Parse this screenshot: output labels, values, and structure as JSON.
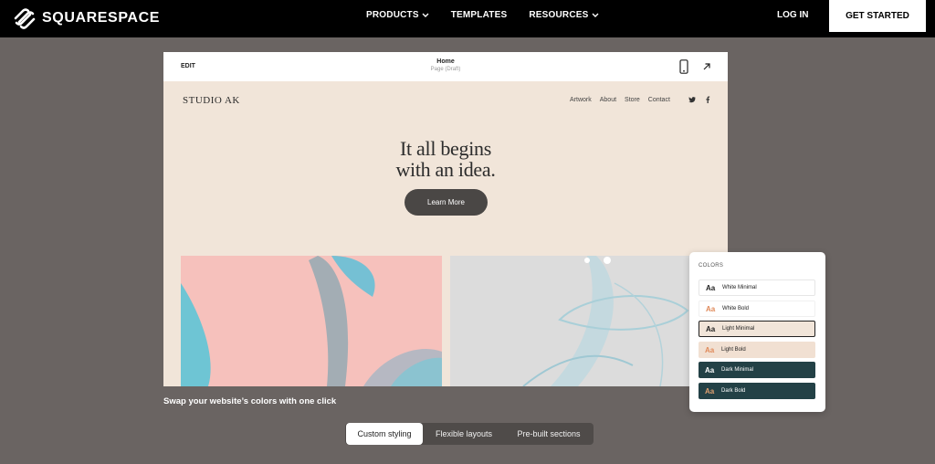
{
  "nav": {
    "brand": "SQUARESPACE",
    "items": [
      {
        "label": "PRODUCTS",
        "has_dropdown": true
      },
      {
        "label": "TEMPLATES",
        "has_dropdown": false
      },
      {
        "label": "RESOURCES",
        "has_dropdown": true
      }
    ],
    "login": "LOG IN",
    "cta": "GET STARTED"
  },
  "editor": {
    "edit_label": "EDIT",
    "page_title": "Home",
    "page_subtitle": "Page (Draft)",
    "icons": [
      "mobile-preview-icon",
      "expand-arrow-icon"
    ]
  },
  "site": {
    "brand": "STUDIO AK",
    "nav": [
      "Artwork",
      "About",
      "Store",
      "Contact"
    ],
    "social_icons": [
      "twitter-icon",
      "facebook-icon"
    ],
    "headline_line1": "It all begins",
    "headline_line2": "with an idea.",
    "button": "Learn More"
  },
  "caption": "Swap your website’s colors with one click",
  "colors_panel": {
    "title": "COLORS",
    "options": [
      {
        "aa": "Aa",
        "label": "White Minimal",
        "bg": "#ffffff",
        "fg": "#222222",
        "aa_color": "#222222",
        "selected": false
      },
      {
        "aa": "Aa",
        "label": "White Bold",
        "bg": "#ffffff",
        "fg": "#222222",
        "aa_color": "#e08a5a",
        "selected": false
      },
      {
        "aa": "Aa",
        "label": "Light Minimal",
        "bg": "#f1e5d9",
        "fg": "#222222",
        "aa_color": "#222222",
        "selected": true
      },
      {
        "aa": "Aa",
        "label": "Light Bold",
        "bg": "#f1e0d2",
        "fg": "#222222",
        "aa_color": "#e08a5a",
        "selected": false
      },
      {
        "aa": "Aa",
        "label": "Dark Minimal",
        "bg": "#234146",
        "fg": "#ffffff",
        "aa_color": "#ffffff",
        "selected": false
      },
      {
        "aa": "Aa",
        "label": "Dark Bold",
        "bg": "#234146",
        "fg": "#ffffff",
        "aa_color": "#e0a070",
        "selected": false
      }
    ]
  },
  "tabs": [
    {
      "label": "Custom styling",
      "active": true
    },
    {
      "label": "Flexible layouts",
      "active": false
    },
    {
      "label": "Pre-built sections",
      "active": false
    }
  ],
  "colors": {
    "nav_bg": "#000000",
    "page_bg": "#6a6462",
    "preview_bg": "#f1e5d9",
    "button_bg": "#4a4745"
  }
}
